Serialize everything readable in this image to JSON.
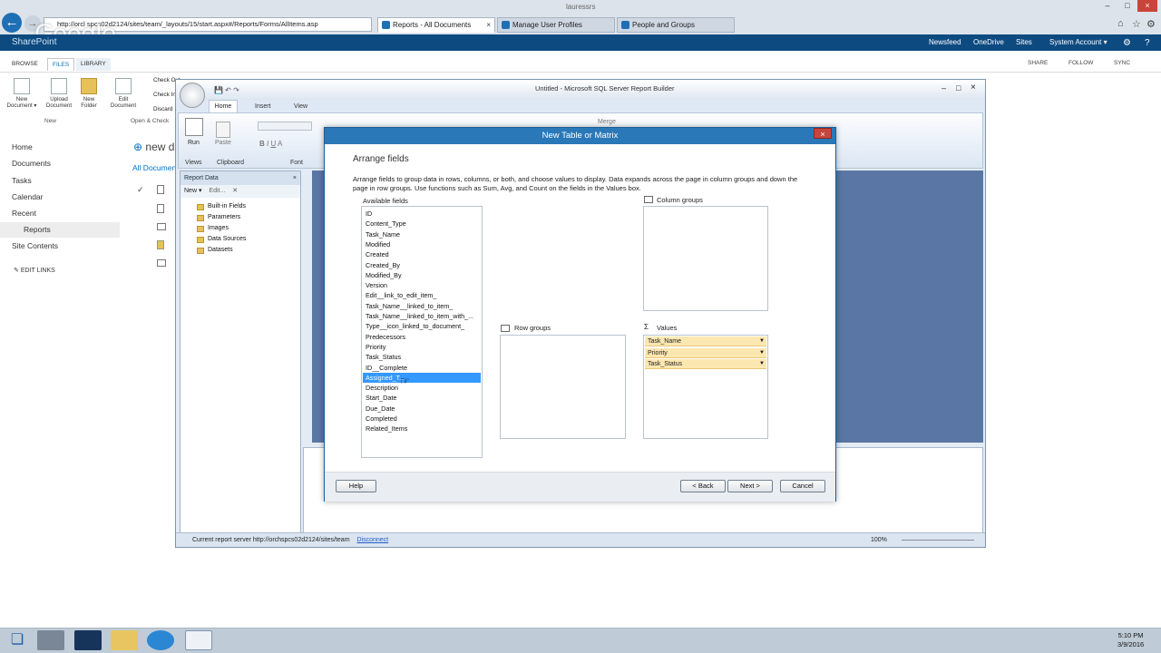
{
  "browser": {
    "address": "http://orcl spcs02d2124/sites/team/_layouts/15/start.aspx#/Reports/Forms/AllItems.asp",
    "window_title": "lauressrs",
    "tabs": [
      {
        "label": "Reports - All Documents"
      },
      {
        "label": "Manage User Profiles"
      },
      {
        "label": "People and Groups"
      }
    ],
    "google_watermark": "Google"
  },
  "sharepoint": {
    "brand": "SharePoint",
    "top_links": [
      "Newsfeed",
      "OneDrive",
      "Sites"
    ],
    "account": "System Account ▾",
    "ribbon_tabs": [
      "BROWSE",
      "FILES",
      "LIBRARY"
    ],
    "actions": [
      "SHARE",
      "FOLLOW",
      "SYNC"
    ],
    "tools": [
      "New Document ▾",
      "Upload Document",
      "New Folder",
      "Edit Document"
    ],
    "group_labels": {
      "new": "New",
      "open": "Open & Check"
    },
    "check_items": [
      "Check Out",
      "Check In",
      "Discard"
    ],
    "nav": [
      "Home",
      "Documents",
      "Tasks",
      "Calendar",
      "Recent",
      "Reports",
      "Site Contents"
    ],
    "edit_links": "EDIT LINKS",
    "new_doc": "new d",
    "all_docs": "All Documen"
  },
  "report_builder": {
    "title": "Untitled - Microsoft SQL Server Report Builder",
    "tabs": [
      "Home",
      "Insert",
      "View"
    ],
    "groups": [
      "Views",
      "Clipboard",
      "Font"
    ],
    "run": "Run",
    "paste": "Paste",
    "merge": "Merge",
    "report_data": {
      "title": "Report Data",
      "new": "New ▾",
      "edit": "Edit...",
      "items": [
        "Built-in Fields",
        "Parameters",
        "Images",
        "Data Sources",
        "Datasets"
      ]
    },
    "status": {
      "server": "Current report server http://orchspcs02d2124/sites/team",
      "disconnect": "Disconnect",
      "zoom": "100%"
    }
  },
  "dialog": {
    "title": "New Table or Matrix",
    "heading": "Arrange fields",
    "description": "Arrange fields to group data in rows, columns, or both, and choose values to display. Data expands across the page in column groups and down the page in row groups.  Use functions such as Sum, Avg, and Count on the fields in the Values box.",
    "available_label": "Available fields",
    "available_fields": [
      "ID",
      "Content_Type",
      "Task_Name",
      "Modified",
      "Created",
      "Created_By",
      "Modified_By",
      "Version",
      "Edit__link_to_edit_item_",
      "Task_Name__linked_to_item_",
      "Task_Name__linked_to_item_with_...",
      "Type__icon_linked_to_document_",
      "Predecessors",
      "Priority",
      "Task_Status",
      "ID__Complete",
      "Assigned_T...",
      "Description",
      "Start_Date",
      "Due_Date",
      "Completed",
      "Related_Items"
    ],
    "selected_field": "Assigned_T...",
    "column_groups_label": "Column groups",
    "row_groups_label": "Row groups",
    "values_label": "Values",
    "values": [
      "Task_Name",
      "Priority",
      "Task_Status"
    ],
    "buttons": {
      "help": "Help",
      "back": "< Back",
      "next": "Next >",
      "cancel": "Cancel"
    }
  },
  "taskbar": {
    "time": "5:10 PM",
    "date": "3/9/2016"
  }
}
